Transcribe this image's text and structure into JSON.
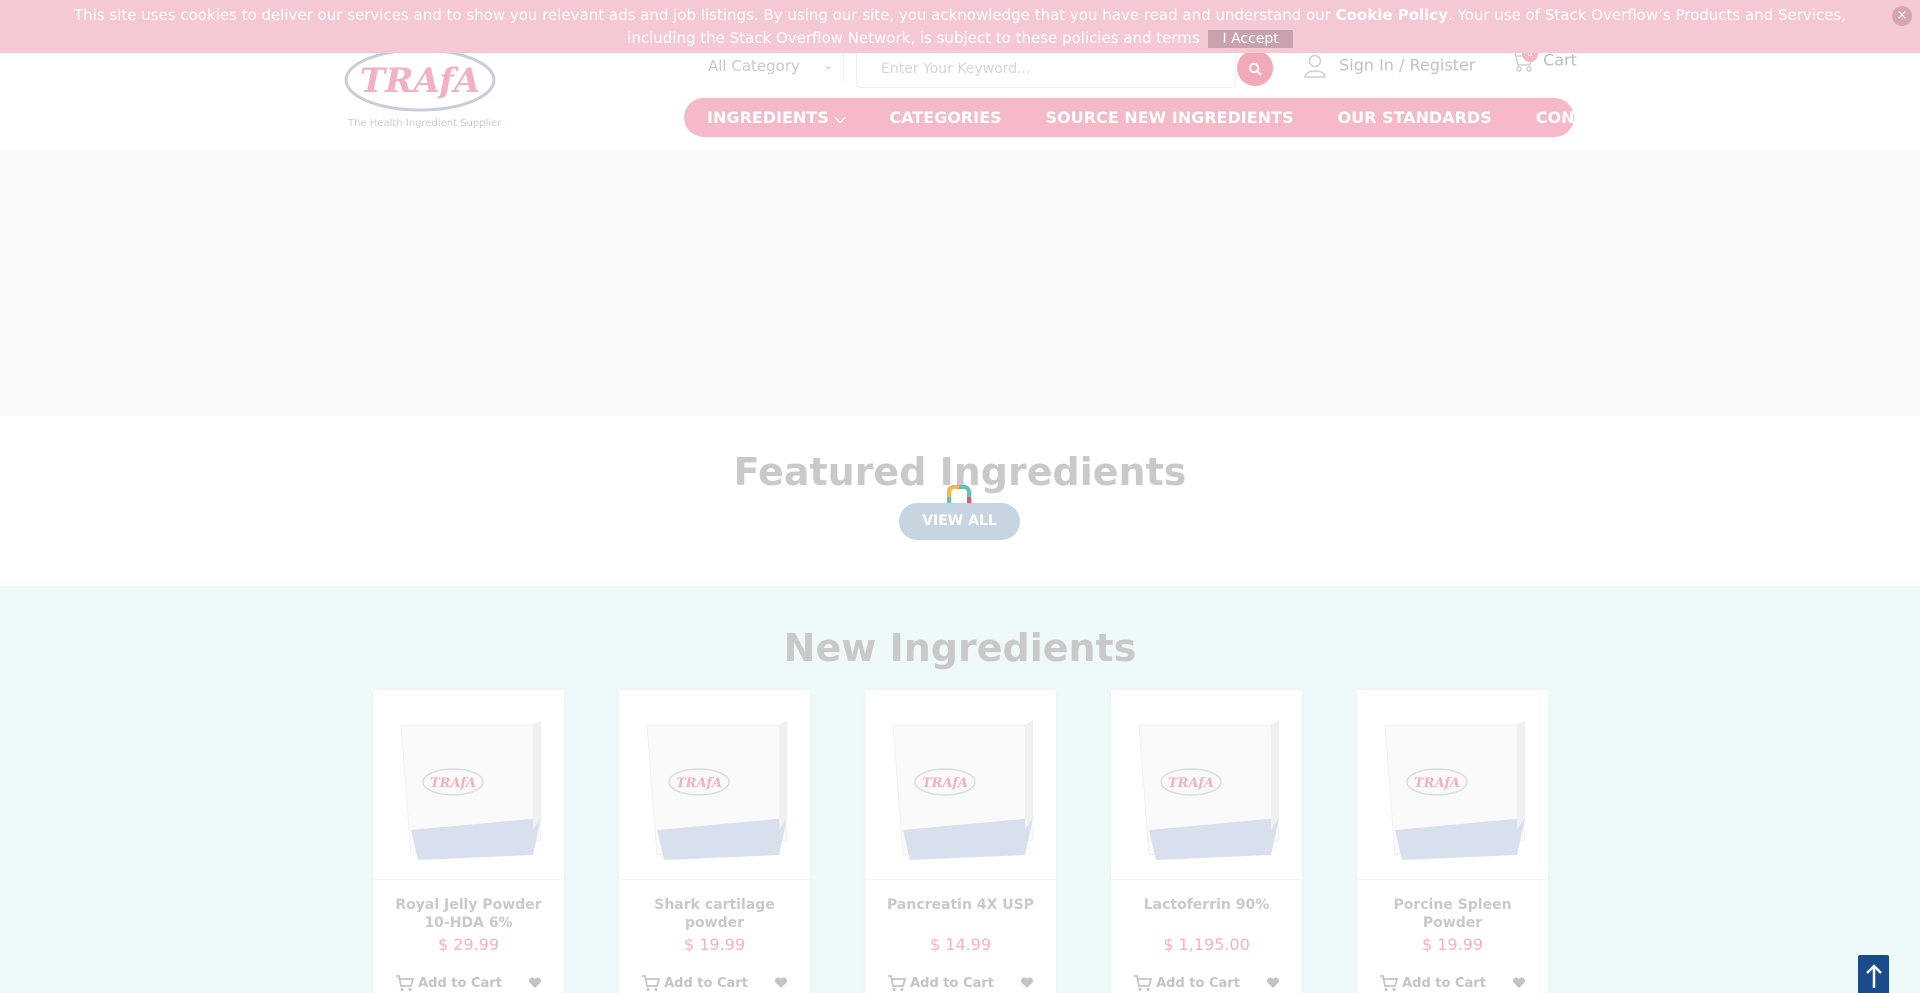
{
  "cookie": {
    "text_before": "This site uses cookies to deliver our services and to show you relevant ads and job listings. By using our site, you acknowledge that you have read and understand our ",
    "link_text": "Cookie Policy",
    "text_after": ". Your use of Stack Overflow’s Products and Services, including the Stack Overflow Network, is subject to these policies and terms",
    "accept_label": "I Accept",
    "close_label": "×"
  },
  "header": {
    "logo_text": "TRAfA",
    "logo_tagline": "The Health Ingredient Supplier",
    "category_select": "All Category",
    "search_placeholder": "Enter Your Keyword...",
    "signin_label": "Sign In / Register",
    "cart_label": "Cart",
    "cart_count": "0"
  },
  "nav": {
    "items": [
      {
        "label": "INGREDIENTS"
      },
      {
        "label": "CATEGORIES"
      },
      {
        "label": "SOURCE NEW INGREDIENTS"
      },
      {
        "label": "OUR STANDARDS"
      },
      {
        "label": "CONTACT US"
      }
    ]
  },
  "featured": {
    "title": "Featured Ingredients",
    "view_all": "VIEW ALL"
  },
  "new_ingredients": {
    "title": "New Ingredients",
    "add_to_cart_label": "Add to Cart",
    "products": [
      {
        "name": "Royal Jelly Powder 10-HDA 6%",
        "price": "$ 29.99"
      },
      {
        "name": "Shark cartilage powder",
        "price": "$ 19.99"
      },
      {
        "name": "Pancreatin 4X USP",
        "price": "$ 14.99"
      },
      {
        "name": "Lactoferrin 90%",
        "price": "$ 1,195.00"
      },
      {
        "name": "Porcine Spleen Powder",
        "price": "$ 19.99"
      }
    ]
  },
  "colors": {
    "accent_pink": "#f5b9c7",
    "price_pink": "#f5b2c1",
    "scroll_top_blue": "#1a4b8c"
  }
}
